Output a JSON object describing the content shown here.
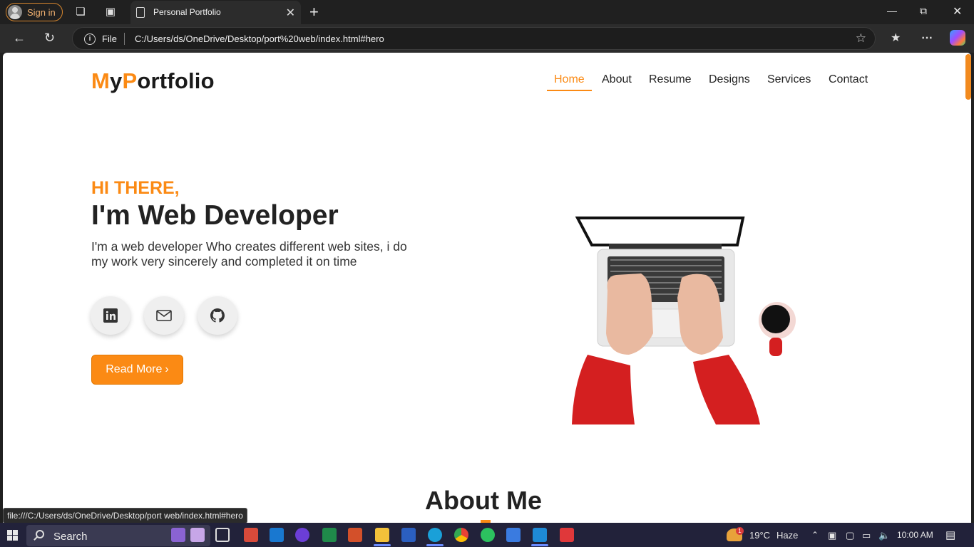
{
  "browser": {
    "signin_label": "Sign in",
    "tab_title": "Personal Portfolio",
    "address_scheme": "File",
    "address_url": "C:/Users/ds/OneDrive/Desktop/port%20web/index.html#hero",
    "status_url": "file:///C:/Users/ds/OneDrive/Desktop/port web/index.html#hero"
  },
  "page": {
    "logo_letters": [
      "M",
      "y",
      "P",
      "ortfolio"
    ],
    "nav": [
      "Home",
      "About",
      "Resume",
      "Designs",
      "Services",
      "Contact"
    ],
    "active_nav": "Home",
    "hero": {
      "greeting": "HI THERE,",
      "headline": "I'm Web Developer",
      "lead": "I'm a web developer Who creates different web sites, i do my work very sincerely and completed it on time",
      "social_icons": [
        "linkedin-icon",
        "mail-icon",
        "github-icon"
      ],
      "button_label": "Read More"
    },
    "about_heading": "About Me",
    "accent_color": "#fb8a14"
  },
  "taskbar": {
    "search_label": "Search",
    "weather_temp": "19°C",
    "weather_desc": "Haze",
    "weather_badge": "1",
    "time": "10:00 AM"
  }
}
